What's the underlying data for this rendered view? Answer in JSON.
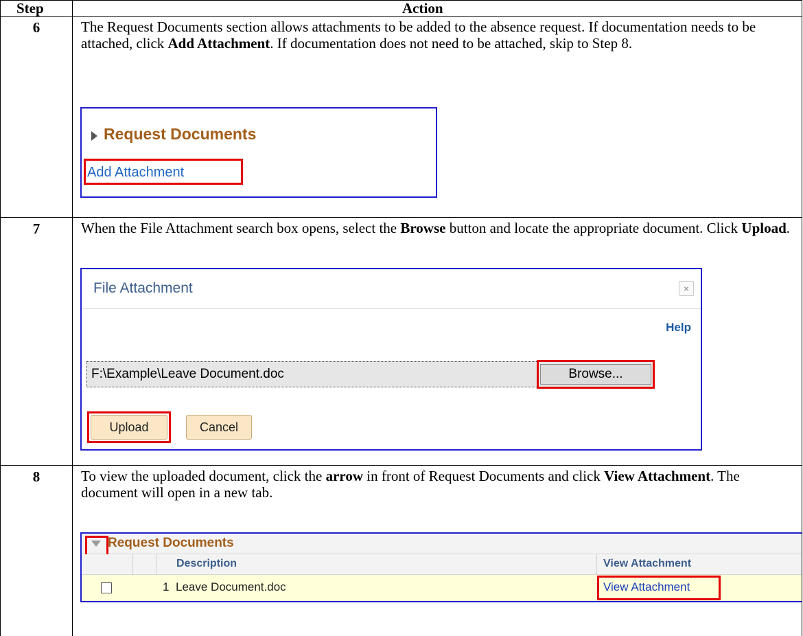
{
  "table": {
    "header": {
      "step": "Step",
      "action": "Action"
    }
  },
  "steps": [
    {
      "number": "6",
      "text": [
        {
          "t": "The Request Documents section allows attachments to be added to the absence request.  If documentation needs to be attached, click "
        },
        {
          "t": "Add Attachment",
          "b": true
        },
        {
          "t": ".  If documentation does not need to be attached, skip to Step 8."
        }
      ],
      "screenshot": {
        "section_title": "Request Documents",
        "link_label": "Add Attachment"
      }
    },
    {
      "number": "7",
      "text": [
        {
          "t": "When the File Attachment search box opens, select the "
        },
        {
          "t": "Browse",
          "b": true
        },
        {
          "t": " button and locate the appropriate document.  Click "
        },
        {
          "t": "Upload",
          "b": true
        },
        {
          "t": "."
        }
      ],
      "screenshot": {
        "dialog_title": "File Attachment",
        "close_glyph": "×",
        "help_label": "Help",
        "file_path": "F:\\Example\\Leave Document.doc",
        "browse_label": "Browse...",
        "upload_label": "Upload",
        "cancel_label": "Cancel"
      }
    },
    {
      "number": "8",
      "text": [
        {
          "t": "To view the uploaded document, click the "
        },
        {
          "t": "arrow",
          "b": true
        },
        {
          "t": " in front of Request Documents and click "
        },
        {
          "t": "View Attachment",
          "b": true
        },
        {
          "t": ".  The document will open in a new tab."
        }
      ],
      "screenshot": {
        "section_title": "Request Documents",
        "columns": {
          "description": "Description",
          "view": "View Attachment"
        },
        "rows": [
          {
            "num": "1",
            "description": "Leave Document.doc",
            "link": "View Attachment",
            "checked": false
          }
        ]
      }
    }
  ],
  "colors": {
    "frame_border": "#1f1fcc",
    "highlight_box": "#e30000",
    "section_title": "#a35e1a",
    "link": "#1f67c2",
    "row_highlight": "#ffffd9",
    "button_fill": "#fbe7c6"
  },
  "icons": {
    "collapsed_arrow": "triangle-right-icon",
    "expanded_arrow": "triangle-down-icon",
    "close": "close-icon"
  }
}
